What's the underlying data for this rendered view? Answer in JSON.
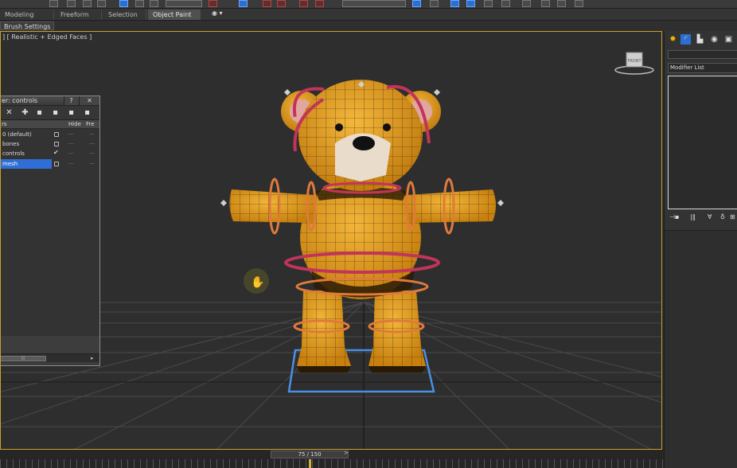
{
  "ribbon": {
    "tabs": [
      {
        "label": "Modeling Tools",
        "active": false
      },
      {
        "label": "Freeform",
        "active": false
      },
      {
        "label": "Selection",
        "active": false
      },
      {
        "label": "Object Paint",
        "active": true
      }
    ],
    "extra_icon": "eye-icon"
  },
  "subribbon": {
    "brush_settings_label": "Brush Settings"
  },
  "viewport": {
    "label": "] [ Realistic + Edged Faces ]",
    "viewcube_label": "FRONT",
    "frame_color": "#c9a227"
  },
  "scene_explorer": {
    "title": "er: controls",
    "help_button": "?",
    "close_button": "✕",
    "toolbar_icons": [
      "close-icon",
      "add-icon",
      "layer-select-icon",
      "layer-add-icon",
      "layer-move-icon",
      "layer-highlight-icon"
    ],
    "columns": {
      "name": "rs",
      "hide": "Hide",
      "freeze": "Fre"
    },
    "layers": [
      {
        "name": "0 (default)",
        "hidden_state": "box",
        "selected": false
      },
      {
        "name": "bones",
        "hidden_state": "box",
        "selected": false
      },
      {
        "name": "controls",
        "hidden_state": "check",
        "selected": false
      },
      {
        "name": "mesh",
        "hidden_state": "box",
        "selected": true
      }
    ],
    "dots": "---",
    "scroll_grip": "|||",
    "scroll_arrow": "▸"
  },
  "command_panel": {
    "tab_icons": [
      "create-icon",
      "modify-icon",
      "hierarchy-icon",
      "motion-icon",
      "display-icon"
    ],
    "modifier_list_label": "Modifier List",
    "stack_tool_icons": [
      "pin-stack-icon",
      "show-end-result-icon",
      "make-unique-icon",
      "remove-modifier-icon",
      "configure-sets-icon"
    ],
    "stack_tool_glyphs": [
      "⊣▪",
      "|‖",
      "∀",
      "♁",
      "⊞"
    ]
  },
  "timeline": {
    "frame_display": "75 / 150",
    "prev_arrow": "<",
    "next_arrow": ">",
    "current_frame": 75,
    "total_frames": 150
  },
  "colors": {
    "bear_body": "#e8a21c",
    "bear_muzzle": "#e9dccb",
    "control_ring_pink": "#c2345a",
    "control_ring_orange": "#e07a3a",
    "selection_blue": "#4a90e2",
    "accent_selected": "#2f6ed6"
  }
}
